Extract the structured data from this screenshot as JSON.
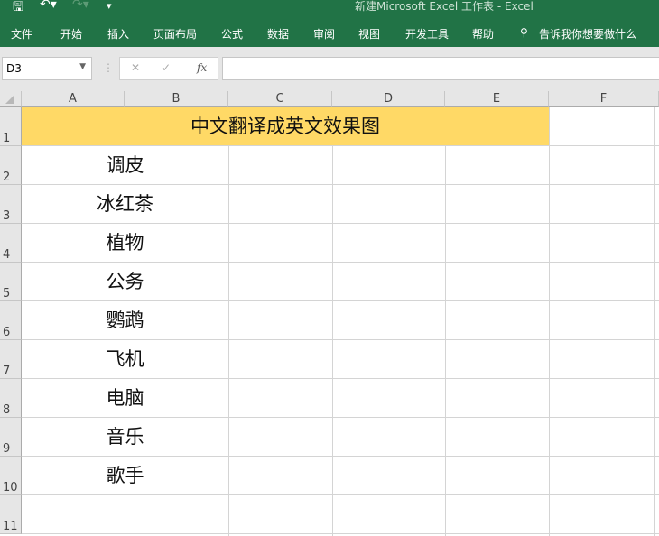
{
  "window": {
    "title": "新建Microsoft Excel 工作表  -  Excel"
  },
  "ribbon": {
    "tabs": [
      "文件",
      "开始",
      "插入",
      "页面布局",
      "公式",
      "数据",
      "审阅",
      "视图",
      "开发工具",
      "帮助"
    ],
    "search": "告诉我你想要做什么"
  },
  "formula_bar": {
    "name_box": "D3",
    "cancel": "✕",
    "enter": "✓",
    "fx": "fx",
    "value": ""
  },
  "columns": [
    "A",
    "B",
    "C",
    "D",
    "E",
    "F"
  ],
  "rows": [
    "1",
    "2",
    "3",
    "4",
    "5",
    "6",
    "7",
    "8",
    "9",
    "10",
    "11"
  ],
  "cells": {
    "title": "中文翻译成英文效果图",
    "items": [
      "调皮",
      "冰红茶",
      "植物",
      "公务",
      "鹦鹉",
      "飞机",
      "电脑",
      "音乐",
      "歌手"
    ]
  },
  "colors": {
    "accent": "#217346",
    "header_fill": "#ffd966"
  }
}
